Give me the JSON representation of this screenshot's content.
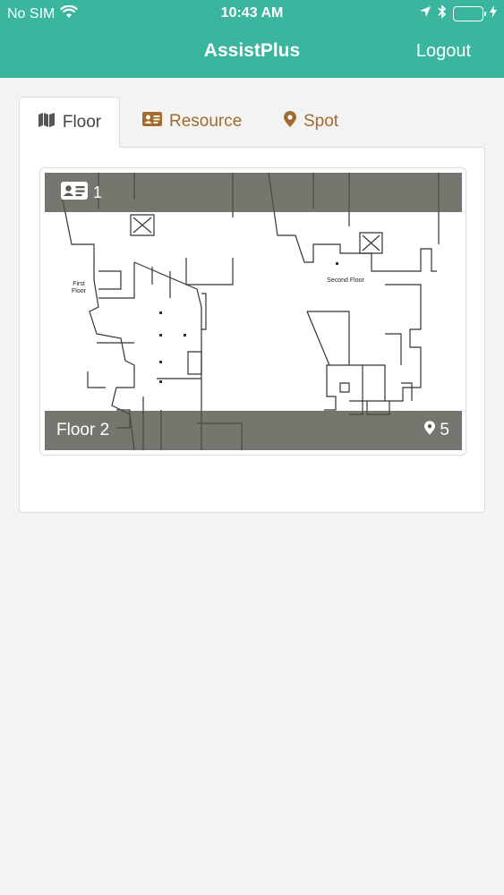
{
  "status_bar": {
    "carrier": "No SIM",
    "time": "10:43 AM",
    "battery_color": "#4cd964"
  },
  "nav": {
    "title": "AssistPlus",
    "logout_label": "Logout",
    "bar_color": "#3ab59e"
  },
  "tabs": [
    {
      "label": "Floor",
      "icon": "map-icon",
      "active": true
    },
    {
      "label": "Resource",
      "icon": "id-card-icon",
      "active": false
    },
    {
      "label": "Spot",
      "icon": "map-marker-icon",
      "active": false
    }
  ],
  "floor_card": {
    "resource_count": "1",
    "floor_name": "Floor 2",
    "spot_count": "5",
    "map_labels": {
      "first_floor": "First\nFloor",
      "second_floor": "Second Floor"
    }
  }
}
